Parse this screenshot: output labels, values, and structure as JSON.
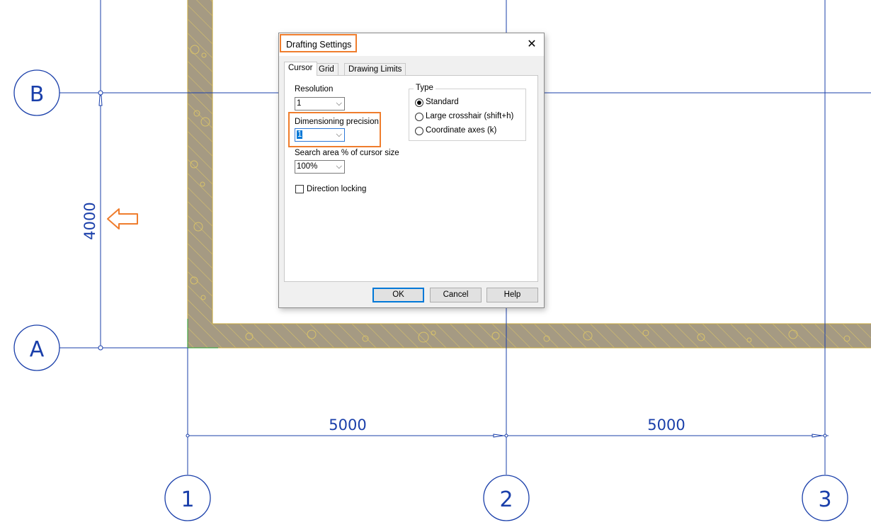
{
  "drawing": {
    "grid_labels": {
      "row_b": "B",
      "row_a": "A",
      "col_1": "1",
      "col_2": "2",
      "col_3": "3"
    },
    "dimensions": {
      "vertical": "4000",
      "horizontal_1": "5000",
      "horizontal_2": "5000"
    },
    "colors": {
      "grid_line": "#1a3faa",
      "wall_fill": "#a59a83",
      "annotation": "#ef7d2d"
    }
  },
  "dialog": {
    "title": "Drafting Settings",
    "close_glyph": "✕",
    "tabs": [
      {
        "label": "Cursor",
        "active": true
      },
      {
        "label": "Grid",
        "active": false
      },
      {
        "label": "Drawing Limits",
        "active": false
      }
    ],
    "resolution": {
      "label": "Resolution",
      "value": "1"
    },
    "dimensioning_precision": {
      "label": "Dimensioning precision",
      "value": "1"
    },
    "search_area": {
      "label": "Search area % of cursor size",
      "value": "100%"
    },
    "direction_locking": {
      "label": "Direction locking",
      "checked": false
    },
    "type_group": {
      "title": "Type",
      "options": [
        {
          "label": "Standard",
          "selected": true
        },
        {
          "label": "Large crosshair (shift+h)",
          "selected": false
        },
        {
          "label": "Coordinate axes (k)",
          "selected": false
        }
      ]
    },
    "buttons": {
      "ok": "OK",
      "cancel": "Cancel",
      "help": "Help"
    }
  }
}
